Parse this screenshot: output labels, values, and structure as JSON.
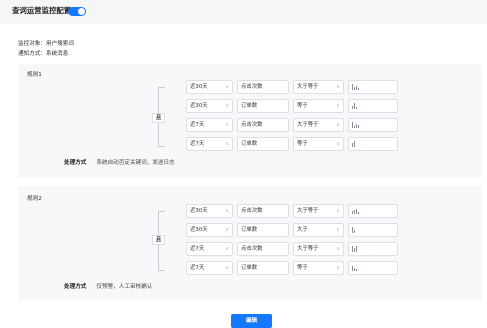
{
  "header": {
    "title": "查词运营监控配置",
    "enabled": true
  },
  "meta": {
    "monitor_target": "监控对象：用户搜索词",
    "notify_method": "通知方式：系统消息"
  },
  "rules": [
    {
      "title": "规则1",
      "logic": "且",
      "conditions": [
        {
          "period": "近30天",
          "metric": "点击次数",
          "operator": "大于等于"
        },
        {
          "period": "近30天",
          "metric": "订单数",
          "operator": "等于"
        },
        {
          "period": "近7天",
          "metric": "点击次数",
          "operator": "大于等于"
        },
        {
          "period": "近7天",
          "metric": "订单数",
          "operator": "等于"
        }
      ],
      "handle_label": "处理方式",
      "handle_value": "系统自动否定关键词，发送日志"
    },
    {
      "title": "规则2",
      "logic": "且",
      "conditions": [
        {
          "period": "近30天",
          "metric": "点击次数",
          "operator": "大于等于"
        },
        {
          "period": "近30天",
          "metric": "订单数",
          "operator": "大于"
        },
        {
          "period": "近7天",
          "metric": "点击次数",
          "operator": "大于等于"
        },
        {
          "period": "近7天",
          "metric": "订单数",
          "operator": "等于"
        }
      ],
      "handle_label": "处理方式",
      "handle_value": "仅预警，人工审核确认"
    }
  ],
  "actions": {
    "edit_label": "编辑"
  },
  "colors": {
    "accent": "#1677ff",
    "panel": "#f7f8fa",
    "header": "#f5f6f8"
  },
  "icons": {
    "select_arrow": "chevron-down-icon"
  }
}
